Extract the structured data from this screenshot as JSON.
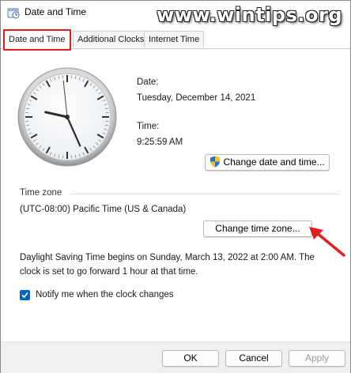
{
  "window": {
    "title": "Date and Time"
  },
  "watermark": "www.wintips.org",
  "tabs": [
    {
      "label": "Date and Time",
      "active": true
    },
    {
      "label": "Additional Clocks",
      "active": false
    },
    {
      "label": "Internet Time",
      "active": false
    }
  ],
  "clock": {
    "hours": 9,
    "minutes": 25,
    "seconds": 59
  },
  "date": {
    "label": "Date:",
    "value": "Tuesday, December 14, 2021"
  },
  "time": {
    "label": "Time:",
    "value": "9:25:59 AM"
  },
  "buttons": {
    "change_date_time": "Change date and time...",
    "change_time_zone": "Change time zone...",
    "ok": "OK",
    "cancel": "Cancel",
    "apply": "Apply"
  },
  "timezone": {
    "header": "Time zone",
    "value": "(UTC-08:00) Pacific Time (US & Canada)"
  },
  "dst": {
    "line1": "Daylight Saving Time begins on Sunday, March 13, 2022 at 2:00 AM. The",
    "line2": "clock is set to go forward 1 hour at that time."
  },
  "notify": {
    "label": "Notify me when the clock changes",
    "checked": true
  },
  "colors": {
    "highlight_red": "#e02020",
    "accent_blue": "#0067c0"
  }
}
